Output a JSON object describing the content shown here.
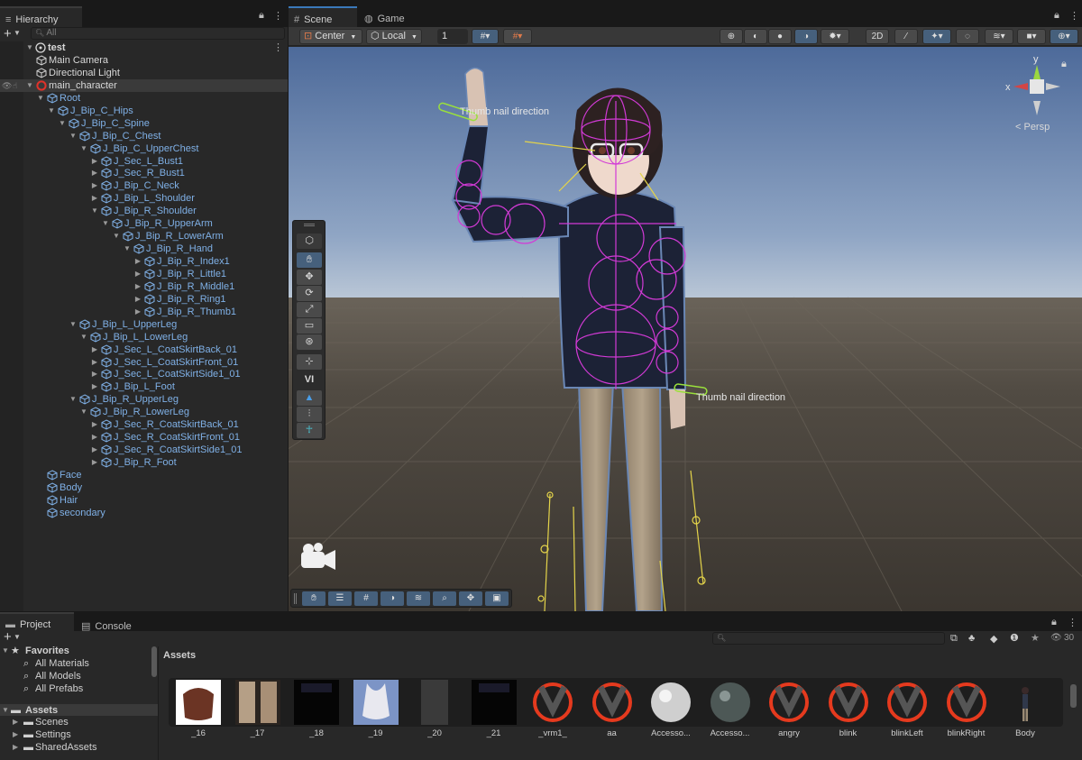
{
  "hierarchy": {
    "tab_title": "Hierarchy",
    "search_placeholder": "All",
    "scene_name": "test",
    "items": [
      {
        "label": "Main Camera",
        "kind": "white"
      },
      {
        "label": "Directional Light",
        "kind": "white"
      },
      {
        "label": "main_character",
        "kind": "white"
      },
      {
        "label": "Root",
        "kind": "blue"
      },
      {
        "label": "J_Bip_C_Hips",
        "kind": "blue"
      },
      {
        "label": "J_Bip_C_Spine",
        "kind": "blue"
      },
      {
        "label": "J_Bip_C_Chest",
        "kind": "blue"
      },
      {
        "label": "J_Bip_C_UpperChest",
        "kind": "blue"
      },
      {
        "label": "J_Sec_L_Bust1",
        "kind": "blue"
      },
      {
        "label": "J_Sec_R_Bust1",
        "kind": "blue"
      },
      {
        "label": "J_Bip_C_Neck",
        "kind": "blue"
      },
      {
        "label": "J_Bip_L_Shoulder",
        "kind": "blue"
      },
      {
        "label": "J_Bip_R_Shoulder",
        "kind": "blue"
      },
      {
        "label": "J_Bip_R_UpperArm",
        "kind": "blue"
      },
      {
        "label": "J_Bip_R_LowerArm",
        "kind": "blue"
      },
      {
        "label": "J_Bip_R_Hand",
        "kind": "blue"
      },
      {
        "label": "J_Bip_R_Index1",
        "kind": "blue"
      },
      {
        "label": "J_Bip_R_Little1",
        "kind": "blue"
      },
      {
        "label": "J_Bip_R_Middle1",
        "kind": "blue"
      },
      {
        "label": "J_Bip_R_Ring1",
        "kind": "blue"
      },
      {
        "label": "J_Bip_R_Thumb1",
        "kind": "blue"
      },
      {
        "label": "J_Bip_L_UpperLeg",
        "kind": "blue"
      },
      {
        "label": "J_Bip_L_LowerLeg",
        "kind": "blue"
      },
      {
        "label": "J_Sec_L_CoatSkirtBack_01",
        "kind": "blue"
      },
      {
        "label": "J_Sec_L_CoatSkirtFront_01",
        "kind": "blue"
      },
      {
        "label": "J_Sec_L_CoatSkirtSide1_01",
        "kind": "blue"
      },
      {
        "label": "J_Bip_L_Foot",
        "kind": "blue"
      },
      {
        "label": "J_Bip_R_UpperLeg",
        "kind": "blue"
      },
      {
        "label": "J_Bip_R_LowerLeg",
        "kind": "blue"
      },
      {
        "label": "J_Sec_R_CoatSkirtBack_01",
        "kind": "blue"
      },
      {
        "label": "J_Sec_R_CoatSkirtFront_01",
        "kind": "blue"
      },
      {
        "label": "J_Sec_R_CoatSkirtSide1_01",
        "kind": "blue"
      },
      {
        "label": "J_Bip_R_Foot",
        "kind": "blue"
      },
      {
        "label": "Face",
        "kind": "blue"
      },
      {
        "label": "Body",
        "kind": "blue"
      },
      {
        "label": "Hair",
        "kind": "blue"
      },
      {
        "label": "secondary",
        "kind": "blue"
      }
    ]
  },
  "scene": {
    "tab_scene": "Scene",
    "tab_game": "Game",
    "pivot_mode": "Center",
    "pivot_rotation": "Local",
    "grid_snap_value": "1",
    "persp_label": "< Persp",
    "gizmo_y": "y",
    "gizmo_x": "x",
    "annotation_1": "Thumb nail direction",
    "annotation_2": "Thumb nail direction",
    "overlay_vi": "VI"
  },
  "project": {
    "tab_project": "Project",
    "tab_console": "Console",
    "favorites_label": "Favorites",
    "favorites": [
      "All Materials",
      "All Models",
      "All Prefabs"
    ],
    "assets_label": "Assets",
    "asset_folders": [
      "Scenes",
      "Settings",
      "SharedAssets"
    ],
    "breadcrumb": "Assets",
    "count": "30",
    "assets": [
      {
        "name": "_16",
        "icon": "texture-brown-icon"
      },
      {
        "name": "_17",
        "icon": "texture-fabric-icon"
      },
      {
        "name": "_18",
        "icon": "texture-black-icon"
      },
      {
        "name": "_19",
        "icon": "texture-blue-icon"
      },
      {
        "name": "_20",
        "icon": "texture-gray-icon"
      },
      {
        "name": "_21",
        "icon": "texture-black-icon"
      },
      {
        "name": "_vrm1_",
        "icon": "vrm-icon"
      },
      {
        "name": "aa",
        "icon": "vrm-icon"
      },
      {
        "name": "Accesso...",
        "icon": "sphere-white-icon"
      },
      {
        "name": "Accesso...",
        "icon": "sphere-glass-icon"
      },
      {
        "name": "angry",
        "icon": "vrm-icon"
      },
      {
        "name": "blink",
        "icon": "vrm-icon"
      },
      {
        "name": "blinkLeft",
        "icon": "vrm-icon"
      },
      {
        "name": "blinkRight",
        "icon": "vrm-icon"
      },
      {
        "name": "Body",
        "icon": "character-icon"
      }
    ]
  }
}
